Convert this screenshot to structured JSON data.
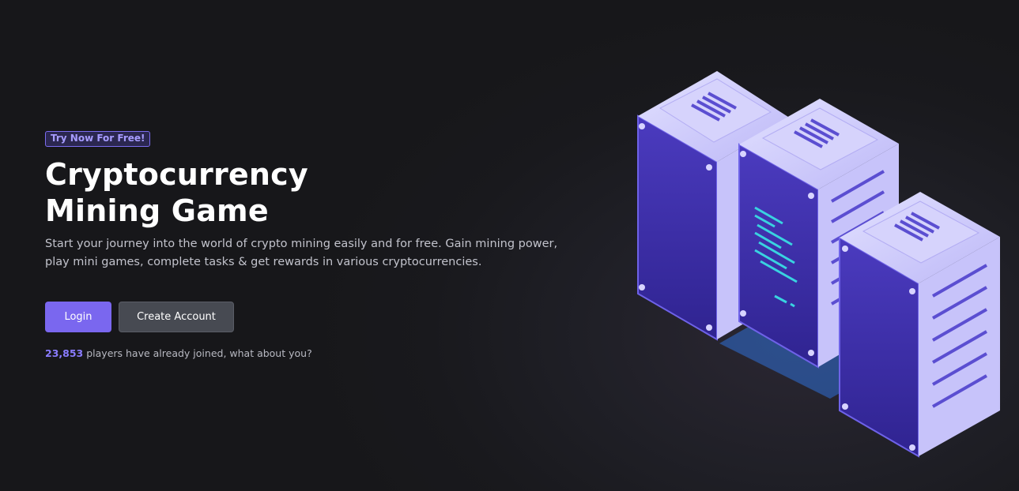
{
  "hero": {
    "badge": "Try Now For Free!",
    "title_line1": "Cryptocurrency",
    "title_line2": "Mining Game",
    "description_line1": "Start your journey into the world of crypto mining easily and for free. Gain mining power,",
    "description_line2": "play mini games, complete tasks & get rewards in various cryptocurrencies.",
    "login_label": "Login",
    "create_account_label": "Create Account",
    "players_count": "23,853",
    "players_text": " players have already joined, what about you?"
  },
  "illustration": {
    "icon": "server-racks-illustration"
  },
  "colors": {
    "accent": "#7a67ef",
    "badge_text": "#a79cff",
    "count": "#8a7cff",
    "server_light": "#c9c6fb",
    "server_dark": "#3d2ea6",
    "screen_code": "#39d3e0"
  }
}
